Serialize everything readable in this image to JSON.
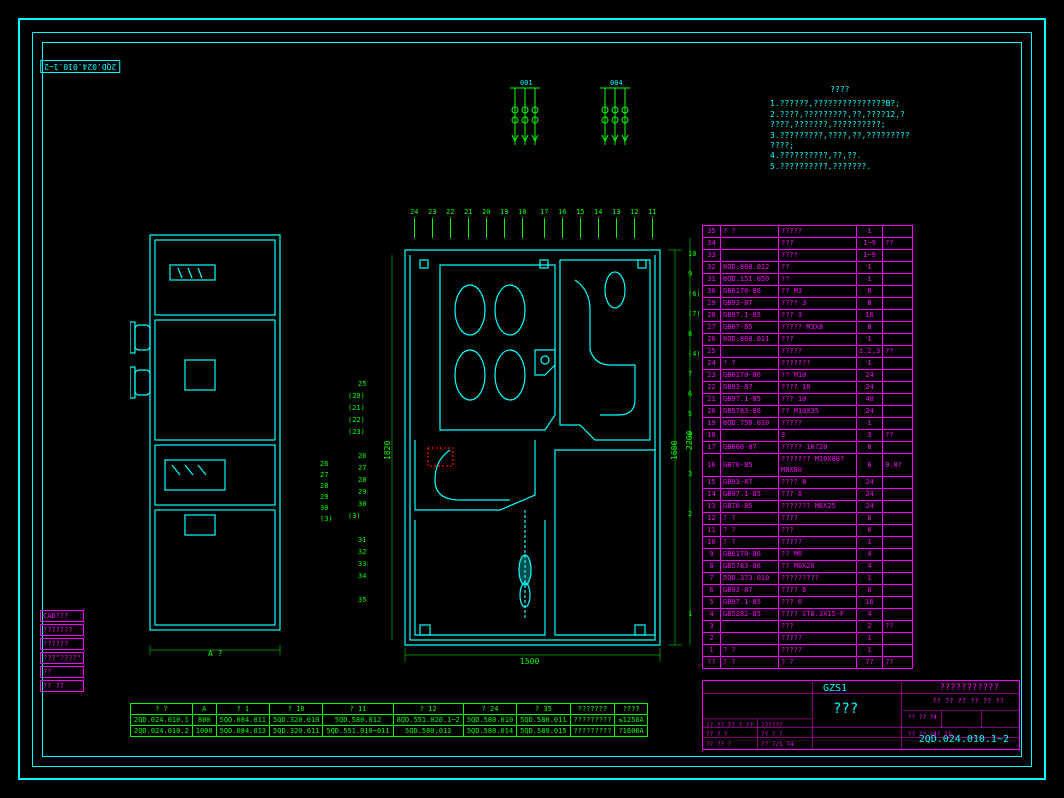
{
  "drawing_number": "2QD.024.010.1~2",
  "rotation_label": "2QD.024.010.1~2",
  "circuit_labels": {
    "left": "001",
    "right": "004"
  },
  "notes": {
    "title": "????",
    "lines": [
      "1.??????,???????????????B?;",
      "2.????,?????????,??,????12,?",
      "  ????,???????,??????????;",
      "3.?????????,????,??,?????????",
      "  ????;",
      "4.??????????,??,??.",
      "5.??????????,???????."
    ]
  },
  "side_labels": [
    "CAD???",
    "???????",
    "??????",
    "???\"????\"",
    "??",
    "??  ??"
  ],
  "callouts_top": [
    "24",
    "23",
    "22",
    "21",
    "20",
    "19",
    "18",
    "",
    "17",
    "16",
    "15",
    "14",
    "13",
    "12",
    "11"
  ],
  "callouts_right": [
    "10",
    "9",
    "(6)",
    "(7)",
    "8",
    "(4)",
    "7",
    "6",
    "5",
    "4",
    "",
    "3",
    "",
    "2",
    "",
    "",
    "",
    "",
    "1"
  ],
  "callouts_left_side": [
    "25",
    "(20)",
    "(21)",
    "(22)",
    "(23)",
    "",
    "26",
    "27",
    "28",
    "29",
    "30",
    "(3)",
    "",
    "31",
    "32",
    "33",
    "34",
    "",
    "35"
  ],
  "front_callouts": [
    "26",
    "27",
    "28",
    "29",
    "30",
    "(3)"
  ],
  "bom": [
    {
      "n": "35",
      "p": "?  ?",
      "d": "?????",
      "q": "1",
      "r": ""
    },
    {
      "n": "34",
      "p": "",
      "d": "???",
      "q": "1~9",
      "r": "??"
    },
    {
      "n": "33",
      "p": "",
      "d": "????",
      "q": "1~9",
      "r": ""
    },
    {
      "n": "32",
      "p": "8QD.868.012",
      "d": "??",
      "q": "1",
      "r": ""
    },
    {
      "n": "31",
      "p": "8QD.151.050",
      "d": "??",
      "q": "1",
      "r": ""
    },
    {
      "n": "30",
      "p": "GB6170-86",
      "d": "?? M3",
      "q": "8",
      "r": ""
    },
    {
      "n": "29",
      "p": "GB93-87",
      "d": "???? 3",
      "q": "8",
      "r": ""
    },
    {
      "n": "28",
      "p": "GB97.1-85",
      "d": "??? 3",
      "q": "16",
      "r": ""
    },
    {
      "n": "27",
      "p": "GB67-85",
      "d": "????? M3X8",
      "q": "8",
      "r": ""
    },
    {
      "n": "26",
      "p": "8QD.868.011",
      "d": "???",
      "q": "1",
      "r": ""
    },
    {
      "n": "25",
      "p": "",
      "d": "?????",
      "q": "2,2,3",
      "r": "??"
    },
    {
      "n": "24",
      "p": "?  ?",
      "d": "???????",
      "q": "1",
      "r": ""
    },
    {
      "n": "23",
      "p": "GB6170-86",
      "d": "?? M10",
      "q": "24",
      "r": ""
    },
    {
      "n": "22",
      "p": "GB93-87",
      "d": "???? 10",
      "q": "24",
      "r": ""
    },
    {
      "n": "21",
      "p": "GB97.1-85",
      "d": "??? 10",
      "q": "48",
      "r": ""
    },
    {
      "n": "20",
      "p": "GB5783-86",
      "d": "?? M10X35",
      "q": "24",
      "r": ""
    },
    {
      "n": "19",
      "p": "8QD.750.010",
      "d": "?????",
      "q": "1",
      "r": ""
    },
    {
      "n": "18",
      "p": "",
      "d": "3",
      "q": "3",
      "r": "??"
    },
    {
      "n": "17",
      "p": "GB860-87",
      "d": "????? 10?20",
      "q": "6",
      "r": ""
    },
    {
      "n": "16",
      "p": "GB70-85",
      "d": "??????? M10X80?M8X80",
      "q": "6",
      "r": "9.8?"
    },
    {
      "n": "15",
      "p": "GB93-87",
      "d": "???? 8",
      "q": "24",
      "r": ""
    },
    {
      "n": "14",
      "p": "GB97.1-85",
      "d": "??? 8",
      "q": "24",
      "r": ""
    },
    {
      "n": "13",
      "p": "GB70-85",
      "d": "??????? M8X25",
      "q": "24",
      "r": ""
    },
    {
      "n": "12",
      "p": "?  ?",
      "d": "????",
      "q": "6",
      "r": ""
    },
    {
      "n": "11",
      "p": "?  ?",
      "d": "???",
      "q": "6",
      "r": ""
    },
    {
      "n": "10",
      "p": "?  ?",
      "d": "?????",
      "q": "1",
      "r": ""
    },
    {
      "n": "9",
      "p": "GB6170-86",
      "d": "?? M6",
      "q": "4",
      "r": ""
    },
    {
      "n": "8",
      "p": "GB5783-86",
      "d": "?? M6X20",
      "q": "4",
      "r": ""
    },
    {
      "n": "7",
      "p": "5QD.373.010",
      "d": "?????????",
      "q": "1",
      "r": ""
    },
    {
      "n": "6",
      "p": "GB93-87",
      "d": "???? 6",
      "q": "8",
      "r": ""
    },
    {
      "n": "5",
      "p": "GB97.1-85",
      "d": "??? 6",
      "q": "16",
      "r": ""
    },
    {
      "n": "4",
      "p": "GB5282-85",
      "d": "???? ST6.3X15-F",
      "q": "4",
      "r": ""
    },
    {
      "n": "3",
      "p": "",
      "d": "???",
      "q": "2",
      "r": "??"
    },
    {
      "n": "2",
      "p": "",
      "d": "?????",
      "q": "1",
      "r": ""
    },
    {
      "n": "1",
      "p": "?  ?",
      "d": "?????",
      "q": "1",
      "r": ""
    }
  ],
  "bom_header": {
    "n": "??",
    "p": "?   ?",
    "d": "?   ?",
    "q": "??",
    "r": "??"
  },
  "title_block": {
    "model": "GZS1",
    "title": "???????????",
    "subtitle": "?? ?? ?? ?? ?? ??",
    "big": "???",
    "dwg": "2QD.024.010.1~2",
    "cells": [
      "?? ?? 7? ? ??",
      "??????",
      "??  ?  ?",
      "??  ?  ?",
      "??  ?? ?",
      "??  7/1  74"
    ],
    "rightcells": [
      "??  7?  74",
      "??  ?? ?4? 21"
    ]
  },
  "bottom_table": {
    "header": [
      "?  ?",
      "A",
      "?  1",
      "?  10",
      "?  11",
      "?  12",
      "?  24",
      "?  35",
      "???????",
      "????"
    ],
    "rows": [
      [
        "2QD.024.010.1",
        "800",
        "5QD.084.011",
        "5QD.320.010",
        "5QD.580.012",
        "8QD.551.020.1~2",
        "5QD.580.010",
        "5QD.580.011",
        "?????????",
        "≤1250A"
      ],
      [
        "2QD.024.010.2",
        "1000",
        "5QD.084.013",
        "5QD.320.011",
        "5QD.551.010~011",
        "5QD.580.013",
        "5QD.580.014",
        "5QD.580.015",
        "?????????",
        "?1600A"
      ]
    ]
  },
  "dimensions": {
    "width": "1500",
    "height_right": "1680",
    "height_far": "2200",
    "height_left": "1820",
    "front_width": "A ?"
  }
}
